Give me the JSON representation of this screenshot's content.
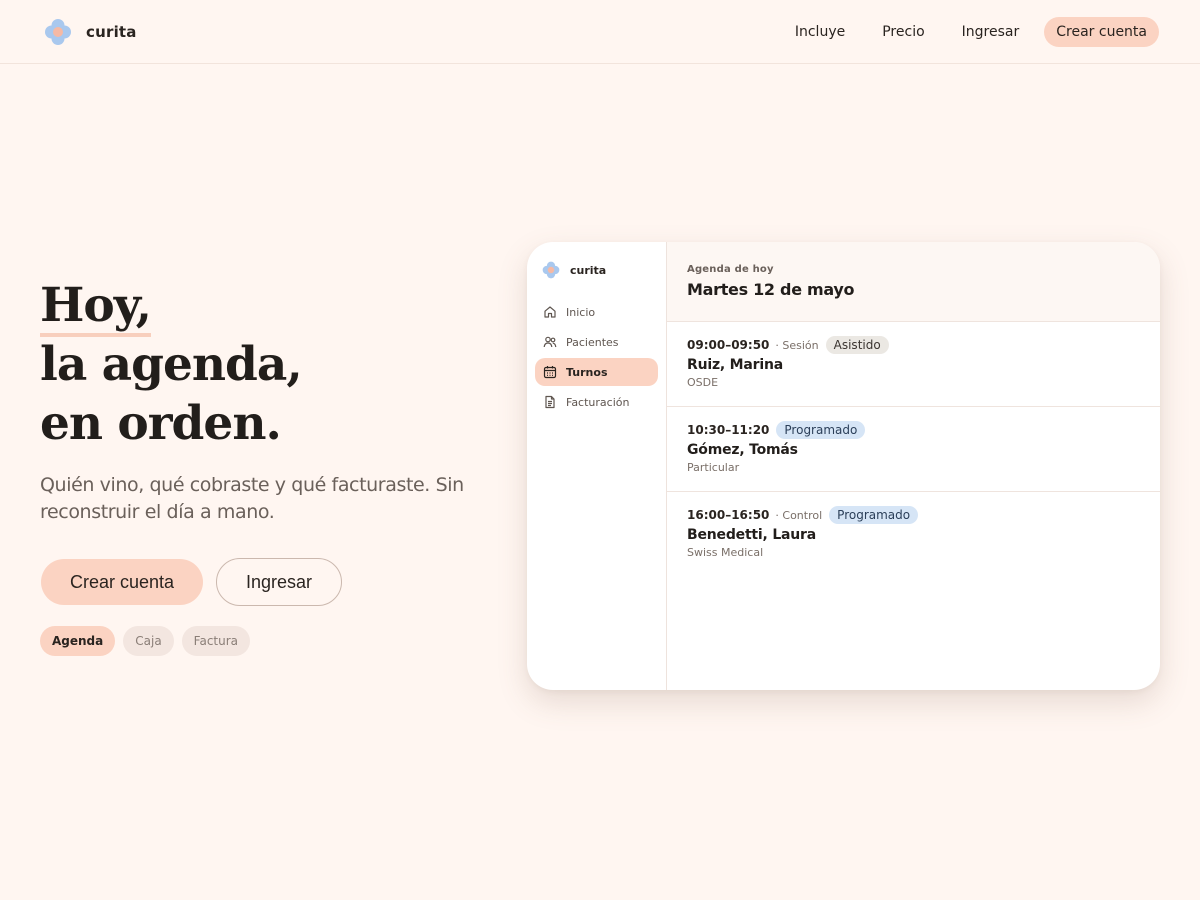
{
  "header": {
    "brand": "curita",
    "nav": [
      "Incluye",
      "Precio",
      "Ingresar"
    ],
    "cta": "Crear cuenta"
  },
  "hero": {
    "title_line1": "Hoy,",
    "title_line2": "la agenda,",
    "title_line3": "en orden.",
    "subtitle": "Quién vino, qué cobraste y qué facturaste. Sin reconstruir el día a mano.",
    "primary_button": "Crear cuenta",
    "secondary_button": "Ingresar",
    "pills": [
      "Agenda",
      "Caja",
      "Factura"
    ],
    "active_pill": "Agenda"
  },
  "app_preview": {
    "brand": "curita",
    "sidebar": [
      {
        "label": "Inicio",
        "icon": "home-icon"
      },
      {
        "label": "Pacientes",
        "icon": "users-icon"
      },
      {
        "label": "Turnos",
        "icon": "calendar-icon"
      },
      {
        "label": "Facturación",
        "icon": "document-icon"
      }
    ],
    "active_item": "Turnos",
    "eyebrow": "Agenda de hoy",
    "date": "Martes 12 de mayo",
    "appointments": [
      {
        "time": "09:00–09:50",
        "type": "· Sesión",
        "status": "Asistido",
        "name": "Ruiz, Marina",
        "coverage": "OSDE"
      },
      {
        "time": "10:30–11:20",
        "type": "",
        "status": "Programado",
        "name": "Gómez, Tomás",
        "coverage": "Particular"
      },
      {
        "time": "16:00–16:50",
        "type": "· Control",
        "status": "Programado",
        "name": "Benedetti, Laura",
        "coverage": "Swiss Medical"
      }
    ]
  },
  "colors": {
    "background": "#fff6f1",
    "accent": "#fbd3c2",
    "status_attended": "#ebe8e3",
    "status_scheduled": "#d6e5f6"
  }
}
